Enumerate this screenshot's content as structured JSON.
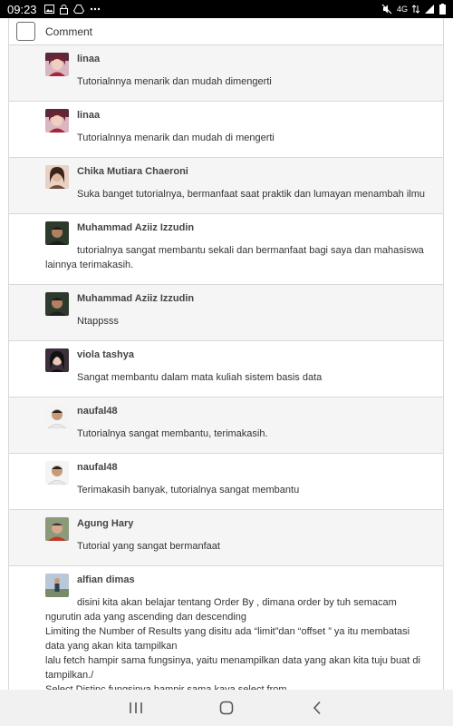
{
  "status_bar": {
    "time": "09:23",
    "left_icons": [
      "gallery-icon",
      "lock-icon",
      "drive-icon",
      "more-icon"
    ],
    "right_icons": [
      "mute-icon",
      "4g-signal-icon",
      "signal-icon",
      "battery-icon"
    ],
    "network_label": "4G"
  },
  "header": {
    "label": "Comment"
  },
  "comments": [
    {
      "author": "linaa",
      "body": [
        "Tutorialnnya menarik dan mudah dimengerti"
      ]
    },
    {
      "author": "linaa",
      "body": [
        "Tutorialnnya menarik dan mudah di mengerti"
      ]
    },
    {
      "author": "Chika Mutiara Chaeroni",
      "body": [
        "Suka banget tutorialnya, bermanfaat saat praktik dan lumayan menambah ilmu"
      ]
    },
    {
      "author": "Muhammad Aziiz Izzudin",
      "body": [
        "tutorialnya sangat membantu sekali dan bermanfaat bagi saya dan mahasiswa lainnya terimakasih."
      ]
    },
    {
      "author": "Muhammad Aziiz Izzudin",
      "body": [
        "Ntappsss"
      ]
    },
    {
      "author": "viola tashya",
      "body": [
        "Sangat membantu dalam mata kuliah sistem basis data"
      ]
    },
    {
      "author": "naufal48",
      "body": [
        "Tutorialnya sangat membantu, terimakasih."
      ]
    },
    {
      "author": "naufal48",
      "body": [
        "Terimakasih banyak, tutorialnya sangat membantu"
      ]
    },
    {
      "author": "Agung Hary",
      "body": [
        "Tutorial yang sangat bermanfaat"
      ]
    },
    {
      "author": "alfian dimas",
      "body": [
        "disini kita akan belajar tentang Order By , dimana order by tuh semacam ngurutin ada yang ascending dan descending",
        "Limiting the Number of Results yang disitu ada “limit”dan “offset ” ya itu membatasi data yang akan kita tampilkan",
        "lalu fetch hampir sama fungsinya, yaitu menampilkan data yang akan kita tuju buat di tampilkan./",
        "Select Distinc fungsinya hampir sama kaya select from."
      ]
    }
  ],
  "nav_bar": {
    "icons": [
      "recent-apps-icon",
      "home-icon",
      "back-icon"
    ]
  }
}
